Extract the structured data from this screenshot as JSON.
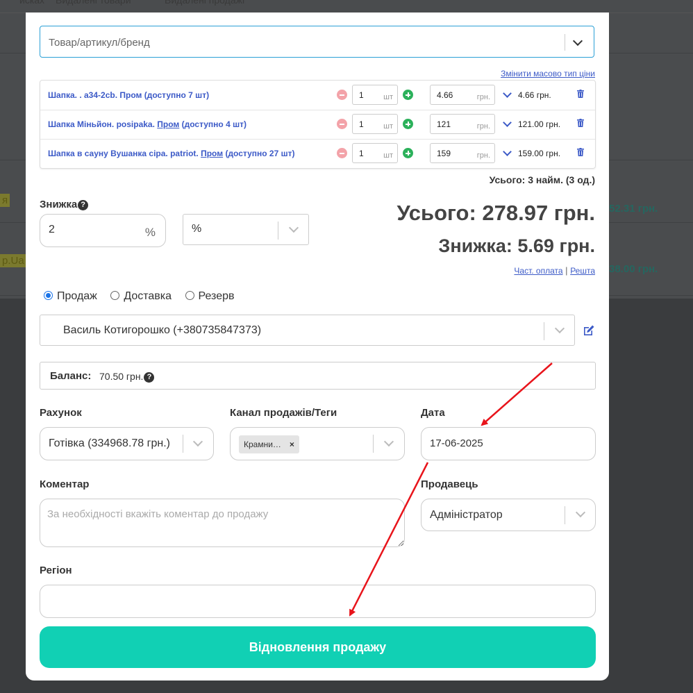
{
  "background": {
    "tabs": [
      "исках",
      "Видалені товари",
      "Видалені продажі"
    ],
    "row_tags": [
      "я",
      "p.Ua"
    ],
    "row_amounts": [
      "52.31 грн.",
      "38.00 грн."
    ]
  },
  "product_search": {
    "placeholder": "Товар/артикул/бренд"
  },
  "bulk_price_link": "Змінити масово тип ціни",
  "items": [
    {
      "name_prefix": "Шапка. . a34-2cb. ",
      "price_type": "Пром",
      "underline": false,
      "availability": " (доступно 7 шт)",
      "qty": "1",
      "qty_unit": "шт",
      "price": "4.66",
      "currency": "грн.",
      "total": "4.66 грн."
    },
    {
      "name_prefix": "Шапка Міньйон. posipaka. ",
      "price_type": "Пром",
      "underline": true,
      "availability": " (доступно 4 шт)",
      "qty": "1",
      "qty_unit": "шт",
      "price": "121",
      "currency": "грн.",
      "total": "121.00 грн."
    },
    {
      "name_prefix": "Шапка в сауну Вушанка сіра. patriot. ",
      "price_type": "Пром",
      "underline": true,
      "availability": " (доступно 27 шт)",
      "qty": "1",
      "qty_unit": "шт",
      "price": "159",
      "currency": "грн.",
      "total": "159.00 грн."
    }
  ],
  "items_summary": "Усього: 3 найм. (3 од.)",
  "discount": {
    "label": "Знижка",
    "value": "2",
    "unit": "%",
    "type_selected": "%"
  },
  "totals": {
    "total": "Усього: 278.97 грн.",
    "discount": "Знижка: 5.69 грн."
  },
  "payment_links": {
    "partial": "Част. оплата",
    "separator": "|",
    "change": "Решта"
  },
  "sale_type": {
    "options": [
      "Продаж",
      "Доставка",
      "Резерв"
    ],
    "selected": "Продаж"
  },
  "customer": {
    "value": "Василь Котигорошко (+380735847373)"
  },
  "balance": {
    "label": "Баланс:",
    "value": "70.50 грн."
  },
  "account": {
    "label": "Рахунок",
    "value": "Готівка (334968.78 грн.)"
  },
  "channel": {
    "label": "Канал продажів/Теги",
    "tag": "Крамни…",
    "tag_remove": "×"
  },
  "date": {
    "label": "Дата",
    "value": "17-06-2025"
  },
  "comment": {
    "label": "Коментар",
    "placeholder": "За необхідності вкажіть коментар до продажу"
  },
  "seller": {
    "label": "Продавець",
    "value": "Адміністратор"
  },
  "region": {
    "label": "Регіон",
    "value": ""
  },
  "submit_label": "Відновлення продажу",
  "colors": {
    "accent": "#11d0b4",
    "link": "#3c5ac7",
    "arrow": "#e8141b",
    "plus": "#2cb15b",
    "minus": "#f3a3a9"
  }
}
